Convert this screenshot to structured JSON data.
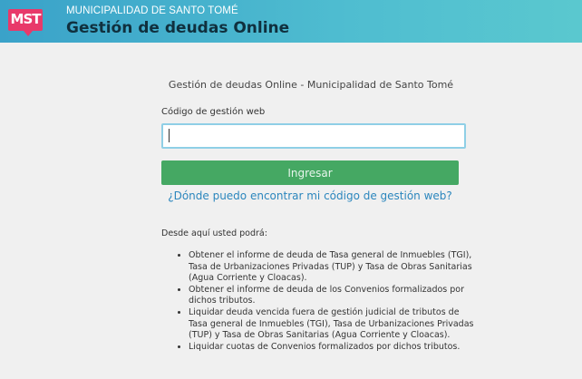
{
  "header": {
    "logo_text": "MST",
    "subtitle": "MUNICIPALIDAD DE SANTO TOMÉ",
    "title": "Gestión de deudas Online"
  },
  "form": {
    "intro": "Gestión de deudas Online - Municipalidad de Santo Tomé",
    "code_label": "Código de gestión web",
    "code_value": "",
    "submit_label": "Ingresar",
    "help_link": "¿Dónde puedo encontrar mi código de gestión web?"
  },
  "info": {
    "intro": "Desde aquí usted podrá:",
    "items": [
      "Obtener el informe de deuda de Tasa general de Inmuebles (TGI), Tasa de Urbanizaciones Privadas (TUP) y Tasa de Obras Sanitarias (Agua Corriente y Cloacas).",
      "Obtener el informe de deuda de los Convenios formalizados por dichos tributos.",
      "Liquidar deuda vencida fuera de gestión judicial de tributos de Tasa general de Inmuebles (TGI), Tasa de Urbanizaciones Privadas (TUP) y Tasa de Obras Sanitarias (Agua Corriente y Cloacas).",
      "Liquidar cuotas de Convenios formalizados por dichos tributos."
    ]
  },
  "colors": {
    "header_start": "#3aa2c9",
    "header_end": "#5ac8cf",
    "logo": "#e8396a",
    "button": "#45a863",
    "link": "#2b86bd"
  }
}
